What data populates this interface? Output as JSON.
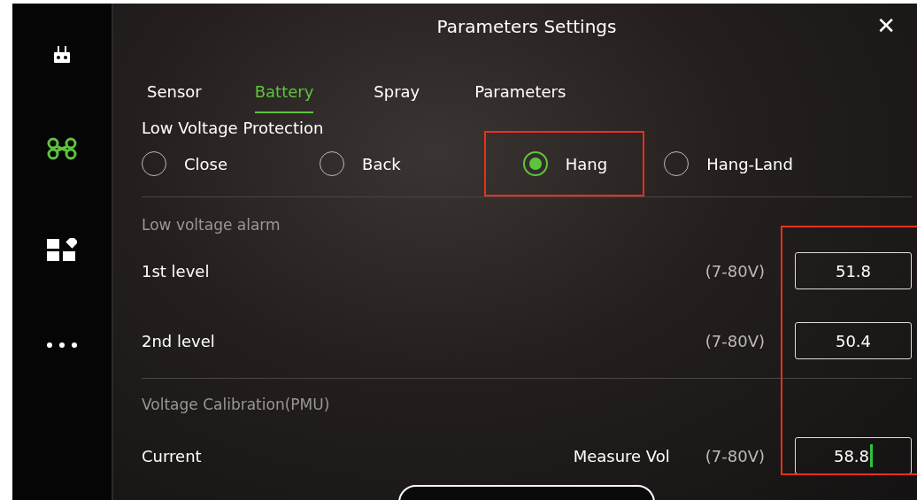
{
  "sidebar": {
    "items": [
      {
        "kind": "remote",
        "selected": false
      },
      {
        "kind": "drone",
        "selected": true
      },
      {
        "kind": "apps",
        "selected": false
      },
      {
        "kind": "more",
        "selected": false
      }
    ]
  },
  "title": "Parameters Settings",
  "close": "✕",
  "tabs": [
    {
      "label": "Sensor",
      "selected": false
    },
    {
      "label": "Battery",
      "selected": true
    },
    {
      "label": "Spray",
      "selected": false
    },
    {
      "label": "Parameters",
      "selected": false
    }
  ],
  "low_voltage_protection": {
    "label": "Low Voltage Protection",
    "options": [
      {
        "label": "Close",
        "selected": false,
        "highlighted": false
      },
      {
        "label": "Back",
        "selected": false,
        "highlighted": false
      },
      {
        "label": "Hang",
        "selected": true,
        "highlighted": true
      },
      {
        "label": "Hang-Land",
        "selected": false,
        "highlighted": false
      }
    ]
  },
  "low_voltage_alarm": {
    "heading": "Low voltage alarm",
    "rows": [
      {
        "label": "1st level",
        "range": "(7-80V)",
        "value": "51.8",
        "focused": false
      },
      {
        "label": "2nd level",
        "range": "(7-80V)",
        "value": "50.4",
        "focused": false
      }
    ]
  },
  "voltage_calibration": {
    "heading": "Voltage Calibration(PMU)",
    "rows": [
      {
        "label": "Current",
        "measure_label": "Measure Vol",
        "range": "(7-80V)",
        "value": "58.8",
        "focused": true
      }
    ]
  },
  "value_fields_highlighted": true
}
